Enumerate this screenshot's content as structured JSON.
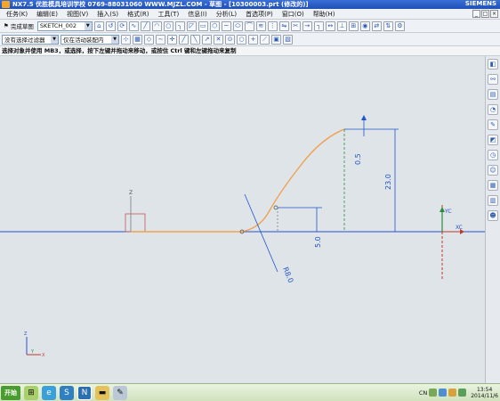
{
  "title": "NX7.5 优胜模具培训学校 0769-88031060 WWW.MJZL.COM - 草图 - [10300003.prt (修改的)]",
  "brand": "SIEMENS",
  "menu": [
    "任务(K)",
    "编辑(E)",
    "视图(V)",
    "插入(S)",
    "格式(R)",
    "工具(T)",
    "信息(I)",
    "分析(L)",
    "首选项(P)",
    "窗口(O)",
    "帮助(H)"
  ],
  "toolbar1": {
    "finish_label": "完成草图",
    "sketch_name": "SKETCH_002"
  },
  "toolbar2": {
    "filter": "没有选择过滤器",
    "assembly": "仅在活动装配内"
  },
  "cue_line": "选择对象并使用 MB3，或选择，按下左键并拖动来移动，或按住 Ctrl 键和左键拖动来复制",
  "dimensions": {
    "d1": "0.5",
    "d2": "23.0",
    "d3": "5.0",
    "r": "R8.0"
  },
  "axes": {
    "xc": "XC",
    "yc": "YC",
    "x": "X",
    "y": "Y",
    "z": "Z"
  },
  "taskbar": {
    "start": "开始",
    "lang": "CN",
    "time": "13:54",
    "date": "2014/11/6"
  },
  "colors": {
    "curve": "#f0a050",
    "axis": "#2a4fd0",
    "dimension": "#1e55c8",
    "accent": "#1f4fb4"
  }
}
